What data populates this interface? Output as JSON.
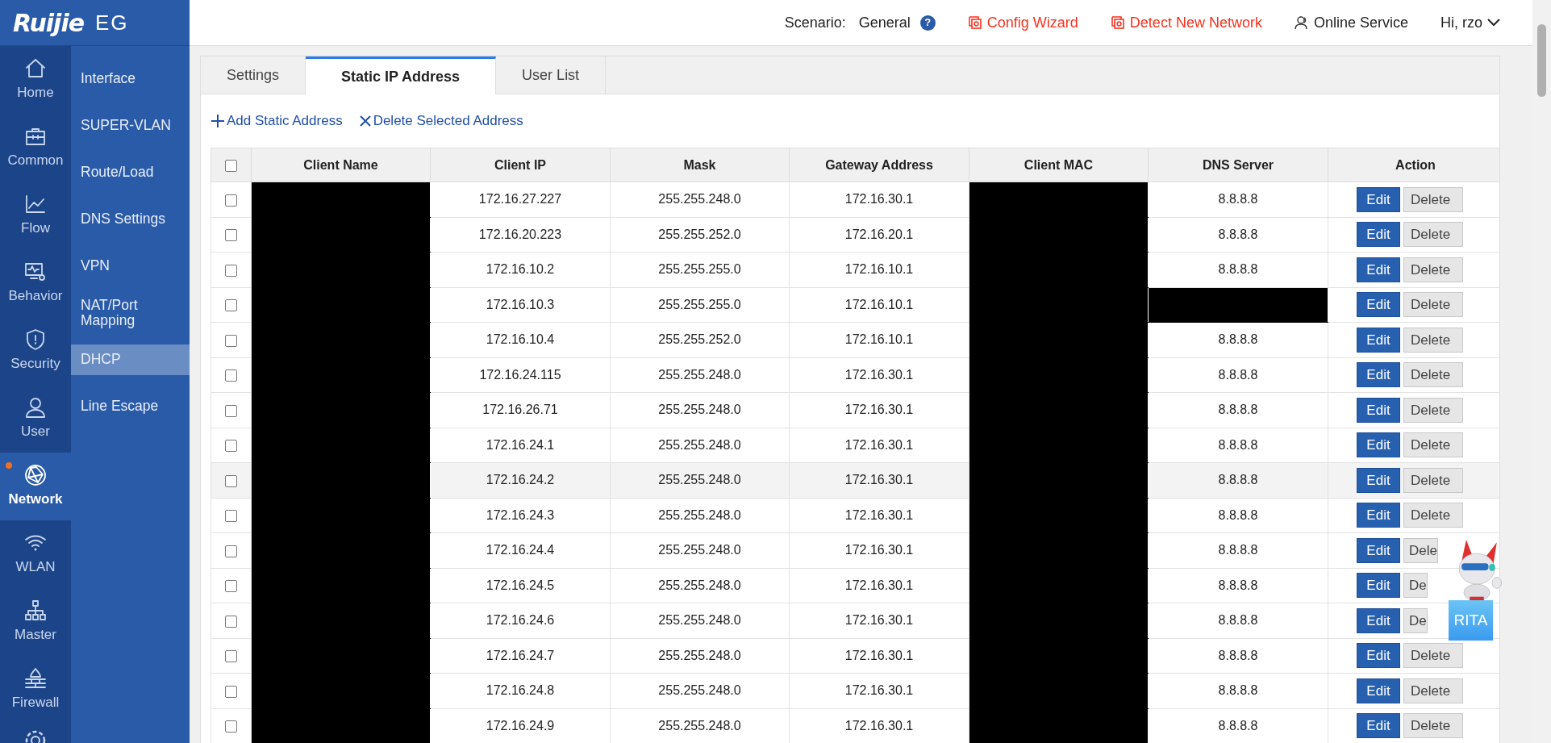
{
  "header": {
    "logo": "Ruijie",
    "product": "EG",
    "scenario_label": "Scenario:",
    "scenario_value": "General",
    "help": "?",
    "links": [
      {
        "label": "Config Wizard",
        "kind": "alert"
      },
      {
        "label": "Detect New Network",
        "kind": "alert"
      },
      {
        "label": "Online Service",
        "kind": "service"
      }
    ],
    "user": "Hi, rzo"
  },
  "sidebar": {
    "items": [
      {
        "label": "Home",
        "selected": false,
        "notice": false
      },
      {
        "label": "Common",
        "selected": false,
        "notice": false
      },
      {
        "label": "Flow",
        "selected": false,
        "notice": false
      },
      {
        "label": "Behavior",
        "selected": false,
        "notice": false
      },
      {
        "label": "Security",
        "selected": false,
        "notice": false
      },
      {
        "label": "User",
        "selected": false,
        "notice": false
      },
      {
        "label": "Network",
        "selected": true,
        "notice": true
      },
      {
        "label": "WLAN",
        "selected": false,
        "notice": false
      },
      {
        "label": "Master",
        "selected": false,
        "notice": false
      },
      {
        "label": "Firewall",
        "selected": false,
        "notice": false
      }
    ]
  },
  "submenu": {
    "items": [
      {
        "label": "Interface",
        "selected": false
      },
      {
        "label": "SUPER-VLAN",
        "selected": false
      },
      {
        "label": "Route/Load",
        "selected": false
      },
      {
        "label": "DNS Settings",
        "selected": false
      },
      {
        "label": "VPN",
        "selected": false
      },
      {
        "label": "NAT/Port Mapping",
        "selected": false
      },
      {
        "label": "DHCP",
        "selected": true
      },
      {
        "label": "Line Escape",
        "selected": false
      }
    ]
  },
  "tabs": [
    {
      "label": "Settings",
      "selected": false
    },
    {
      "label": "Static IP Address",
      "selected": true
    },
    {
      "label": "User List",
      "selected": false
    }
  ],
  "toolbar": [
    {
      "label": "Add Static Address",
      "kind": "add"
    },
    {
      "label": "Delete Selected Address",
      "kind": "delete"
    }
  ],
  "table": {
    "columns": [
      {
        "label": "Client Name"
      },
      {
        "label": "Client IP"
      },
      {
        "label": "Mask"
      },
      {
        "label": "Gateway Address"
      },
      {
        "label": "Client MAC"
      },
      {
        "label": "DNS Server"
      },
      {
        "label": "Action"
      }
    ],
    "select_all_checked": false,
    "rows": [
      {
        "checked": false,
        "highlighted": false,
        "ip": "172.16.27.227",
        "mask": "255.255.248.0",
        "gateway": "172.16.30.1",
        "dns": "8.8.8.8",
        "edit": "Edit",
        "delete": "Delete"
      },
      {
        "checked": false,
        "highlighted": false,
        "ip": "172.16.20.223",
        "mask": "255.255.252.0",
        "gateway": "172.16.20.1",
        "dns": "8.8.8.8",
        "edit": "Edit",
        "delete": "Delete"
      },
      {
        "checked": false,
        "highlighted": false,
        "ip": "172.16.10.2",
        "mask": "255.255.255.0",
        "gateway": "172.16.10.1",
        "dns": "8.8.8.8",
        "edit": "Edit",
        "delete": "Delete"
      },
      {
        "checked": false,
        "highlighted": false,
        "ip": "172.16.10.3",
        "mask": "255.255.255.0",
        "gateway": "172.16.10.1",
        "edit": "Edit",
        "delete": "Delete"
      },
      {
        "checked": false,
        "highlighted": false,
        "ip": "172.16.10.4",
        "mask": "255.255.252.0",
        "gateway": "172.16.10.1",
        "dns": "8.8.8.8",
        "edit": "Edit",
        "delete": "Delete"
      },
      {
        "checked": false,
        "highlighted": false,
        "ip": "172.16.24.115",
        "mask": "255.255.248.0",
        "gateway": "172.16.30.1",
        "dns": "8.8.8.8",
        "edit": "Edit",
        "delete": "Delete"
      },
      {
        "checked": false,
        "highlighted": false,
        "ip": "172.16.26.71",
        "mask": "255.255.248.0",
        "gateway": "172.16.30.1",
        "dns": "8.8.8.8",
        "edit": "Edit",
        "delete": "Delete"
      },
      {
        "checked": false,
        "highlighted": false,
        "ip": "172.16.24.1",
        "mask": "255.255.248.0",
        "gateway": "172.16.30.1",
        "dns": "8.8.8.8",
        "edit": "Edit",
        "delete": "Delete"
      },
      {
        "checked": false,
        "highlighted": true,
        "ip": "172.16.24.2",
        "mask": "255.255.248.0",
        "gateway": "172.16.30.1",
        "dns": "8.8.8.8",
        "edit": "Edit",
        "delete": "Delete"
      },
      {
        "checked": false,
        "highlighted": false,
        "ip": "172.16.24.3",
        "mask": "255.255.248.0",
        "gateway": "172.16.30.1",
        "dns": "8.8.8.8",
        "edit": "Edit",
        "delete": "Delete"
      },
      {
        "checked": false,
        "highlighted": false,
        "ip": "172.16.24.4",
        "mask": "255.255.248.0",
        "gateway": "172.16.30.1",
        "dns": "8.8.8.8",
        "edit": "Edit",
        "delete": "Dele"
      },
      {
        "checked": false,
        "highlighted": false,
        "ip": "172.16.24.5",
        "mask": "255.255.248.0",
        "gateway": "172.16.30.1",
        "dns": "8.8.8.8",
        "edit": "Edit",
        "delete": "De"
      },
      {
        "checked": false,
        "highlighted": false,
        "ip": "172.16.24.6",
        "mask": "255.255.248.0",
        "gateway": "172.16.30.1",
        "dns": "8.8.8.8",
        "edit": "Edit",
        "delete": "De"
      },
      {
        "checked": false,
        "highlighted": false,
        "ip": "172.16.24.7",
        "mask": "255.255.248.0",
        "gateway": "172.16.30.1",
        "dns": "8.8.8.8",
        "edit": "Edit",
        "delete": "Delete"
      },
      {
        "checked": false,
        "highlighted": false,
        "ip": "172.16.24.8",
        "mask": "255.255.248.0",
        "gateway": "172.16.30.1",
        "dns": "8.8.8.8",
        "edit": "Edit",
        "delete": "Delete"
      },
      {
        "checked": false,
        "highlighted": false,
        "ip": "172.16.24.9",
        "mask": "255.255.248.0",
        "gateway": "172.16.30.1",
        "dns": "8.8.8.8",
        "edit": "Edit",
        "delete": "Delete"
      }
    ]
  },
  "assistant": {
    "label": "RITA"
  }
}
